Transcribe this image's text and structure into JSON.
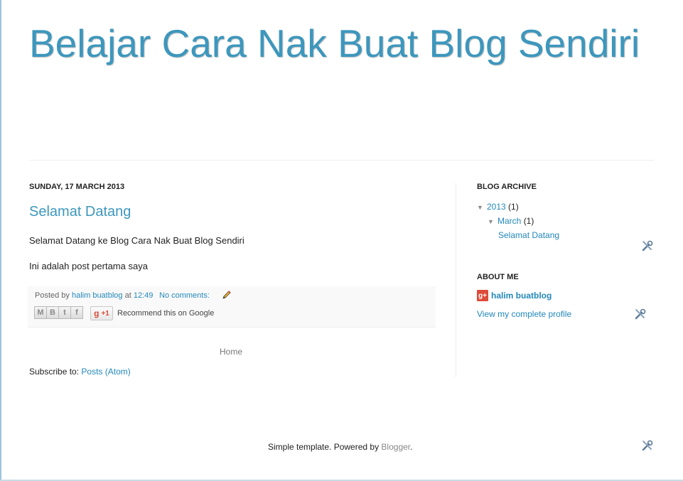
{
  "header": {
    "title": "Belajar Cara Nak Buat Blog Sendiri"
  },
  "post": {
    "date": "SUNDAY, 17 MARCH 2013",
    "title": "Selamat Datang",
    "paragraphs": [
      "Selamat Datang ke Blog Cara Nak Buat Blog Sendiri",
      "Ini adalah post pertama saya"
    ],
    "footer": {
      "posted_by_label": "Posted by",
      "author": "halim buatblog",
      "at_label": "at",
      "time": "12:49",
      "comments": "No comments:",
      "share_buttons": [
        "M",
        "B",
        "t",
        "f"
      ],
      "plusone_label": "+1",
      "recommend_text": "Recommend this on Google"
    }
  },
  "nav": {
    "home": "Home"
  },
  "subscribe": {
    "label": "Subscribe to:",
    "link": "Posts (Atom)"
  },
  "sidebar": {
    "archive": {
      "title": "BLOG ARCHIVE",
      "year": "2013",
      "year_count": "(1)",
      "month": "March",
      "month_count": "(1)",
      "post": "Selamat Datang"
    },
    "about": {
      "title": "ABOUT ME",
      "gplus_label": "g+",
      "name": "halim buatblog",
      "profile_link": "View my complete profile"
    }
  },
  "footer": {
    "text_before": "Simple template. Powered by ",
    "blogger": "Blogger",
    "text_after": "."
  },
  "colors": {
    "title": "#3d97bd",
    "link": "#2288bb",
    "gplus": "#dd4b39"
  },
  "icons": [
    "pencil-icon",
    "tools-icon",
    "triangle-down-icon",
    "gplus-icon"
  ]
}
